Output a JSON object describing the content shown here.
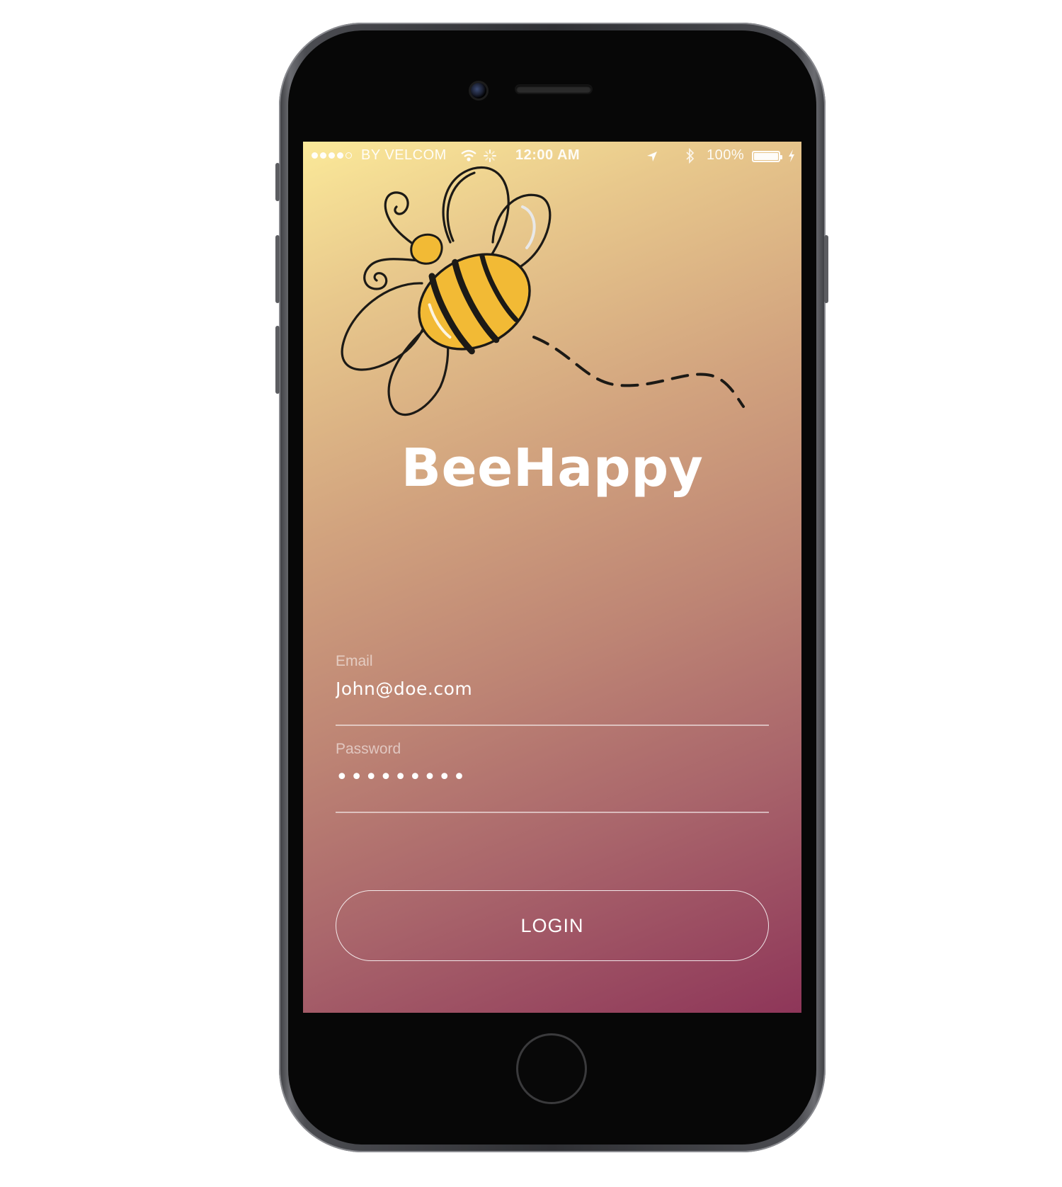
{
  "status_bar": {
    "carrier": "BY VELCOM",
    "time": "12:00 AM",
    "battery_text": "100%",
    "battery_level": 1.0,
    "icons": [
      "signal-dots-icon",
      "wifi-icon",
      "activity-spinner-icon",
      "location-arrow-icon",
      "bluetooth-icon",
      "battery-icon",
      "charging-bolt-icon"
    ]
  },
  "app": {
    "title": "BeeHappy",
    "logo": "bee-icon"
  },
  "login_form": {
    "email_label": "Email",
    "email_value": "John@doe.com",
    "password_label": "Password",
    "password_value": "•••••••••",
    "login_button": "LOGIN"
  },
  "colors": {
    "gradient_top": "#fbe999",
    "gradient_bottom": "#8e3659",
    "bee_body": "#f2ba35",
    "text": "#ffffff"
  }
}
